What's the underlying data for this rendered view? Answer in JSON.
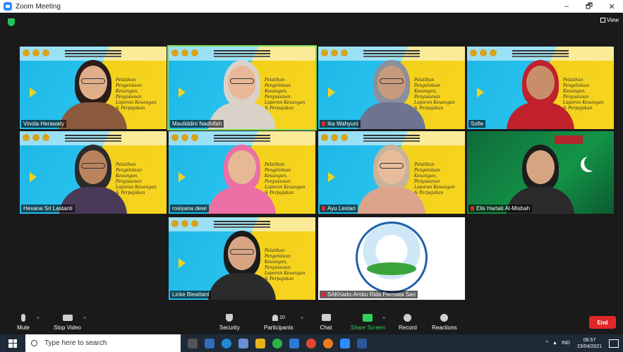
{
  "window": {
    "title": "Zoom Meeting",
    "controls": [
      "–",
      "🗗",
      "✕"
    ]
  },
  "view_button": "View",
  "participants": [
    {
      "name": "Vinola Herawaty",
      "muted": false,
      "style": "event"
    },
    {
      "name": "Mauliddini Nadhifah",
      "muted": false,
      "style": "event",
      "speaking": true
    },
    {
      "name": "Ika Wahyuni",
      "muted": true,
      "style": "event"
    },
    {
      "name": "Sofie",
      "muted": false,
      "style": "event"
    },
    {
      "name": "Hexana Sri Lastanti",
      "muted": false,
      "style": "event"
    },
    {
      "name": "rosiyana dewi",
      "muted": false,
      "style": "event"
    },
    {
      "name": "Ayu Lestari",
      "muted": true,
      "style": "event"
    },
    {
      "name": "Elis Hartati Al-Misbah",
      "muted": true,
      "style": "green"
    },
    {
      "name": "Licke Bieattant",
      "muted": false,
      "style": "event"
    },
    {
      "name": "SAKhado-Ambu Rida Permata Sari",
      "muted": true,
      "style": "logo"
    }
  ],
  "event_script": "Pelatihan Pengelolaan Keuangan, Penyusunan Laporan Keuangan & Perpajakan",
  "toolbar": {
    "mute": "Mute",
    "stop_video": "Stop Video",
    "security": "Security",
    "participants": "Participants",
    "participants_count": "10",
    "chat": "Chat",
    "share_screen": "Share Screen",
    "record": "Record",
    "reactions": "Reactions",
    "end": "End"
  },
  "taskbar": {
    "search_placeholder": "Type here to search",
    "language": "IND",
    "time": "08.57",
    "date": "23/04/2021"
  },
  "colors": {
    "end": "#e02828",
    "share": "#30d158",
    "speaker_outline": "#7ed957"
  }
}
